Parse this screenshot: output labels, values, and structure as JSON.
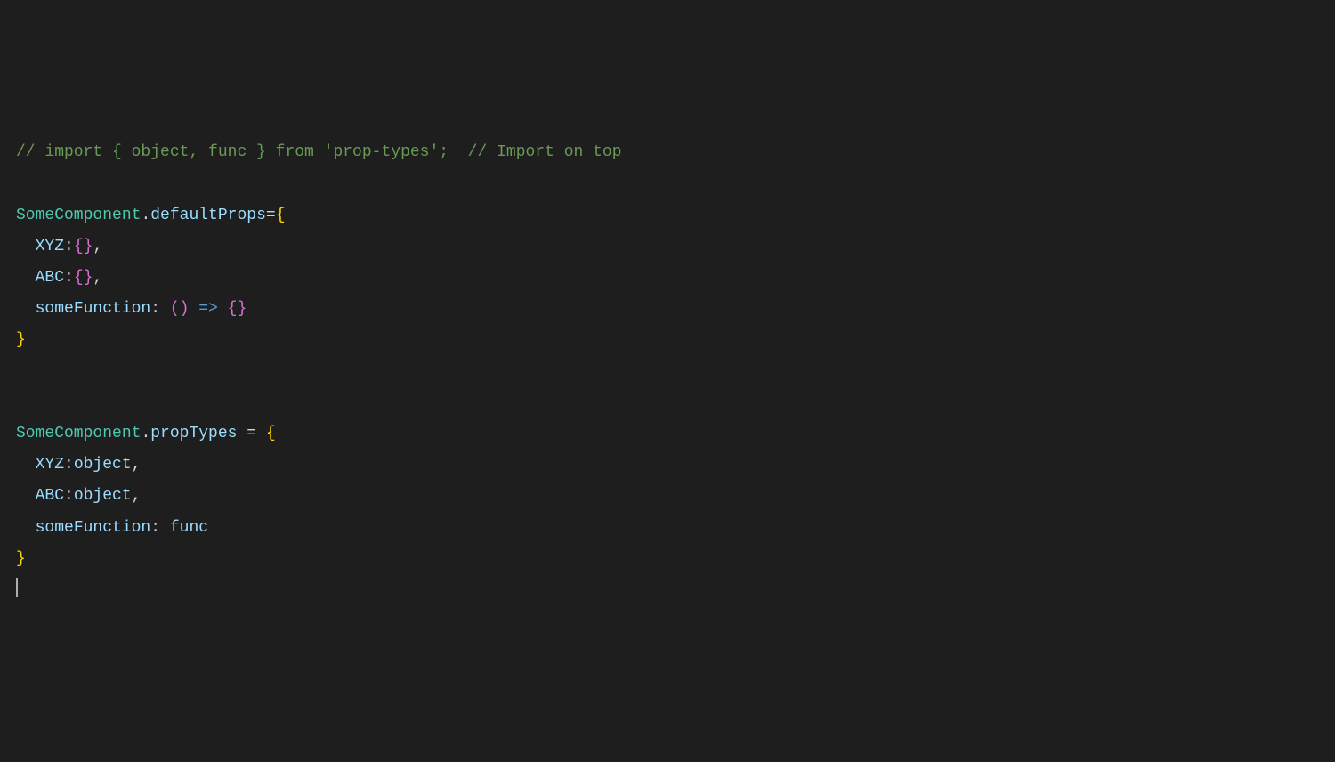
{
  "code": {
    "line1": {
      "comment1": "// import { object, func } from 'prop-types';  // Import on top"
    },
    "line3": {
      "component": "SomeComponent",
      "dot": ".",
      "member": "defaultProps",
      "equals": "=",
      "brace": "{"
    },
    "line4": {
      "prop": "XYZ",
      "colon": ":",
      "braces": "{}",
      "comma": ","
    },
    "line5": {
      "prop": "ABC",
      "colon": ":",
      "braces": "{}",
      "comma": ","
    },
    "line6": {
      "prop": "someFunction",
      "colon": ": ",
      "parens": "()",
      "arrow": " => ",
      "braces": "{}"
    },
    "line7": {
      "brace": "}"
    },
    "line10": {
      "component": "SomeComponent",
      "dot": ".",
      "member": "propTypes",
      "equals": " = ",
      "brace": "{"
    },
    "line11": {
      "prop": "XYZ",
      "colon": ":",
      "type": "object",
      "comma": ","
    },
    "line12": {
      "prop": "ABC",
      "colon": ":",
      "type": "object",
      "comma": ","
    },
    "line13": {
      "prop": "someFunction",
      "colon": ": ",
      "type": "func"
    },
    "line14": {
      "brace": "}"
    }
  }
}
